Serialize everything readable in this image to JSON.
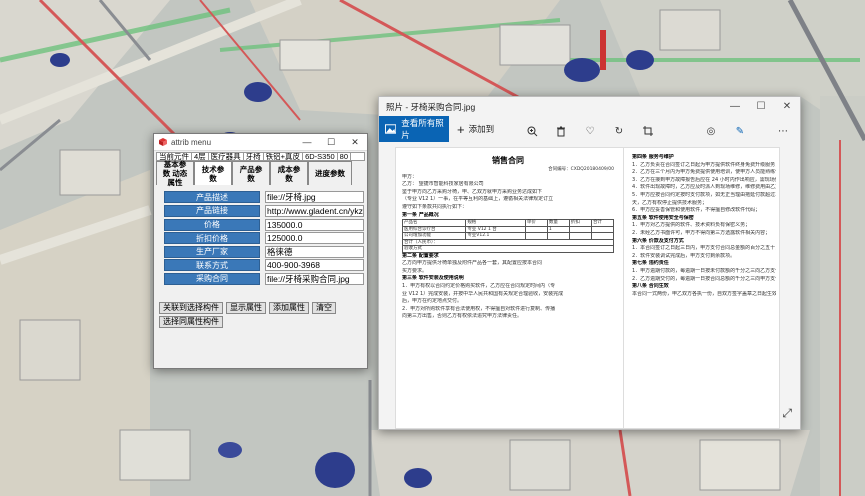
{
  "attrib": {
    "title": "attrib menu",
    "current_row": [
      "当前元件",
      "4层",
      "医疗器具",
      "牙椅",
      "铁铝+真皮",
      "6D-S350",
      "80"
    ],
    "tabs": [
      "基本参数 动态属性",
      "技术参数",
      "产品参数",
      "成本参数",
      "进度参数"
    ],
    "fields": [
      {
        "label": "产品描述",
        "value": "file://牙椅.jpg"
      },
      {
        "label": "产品链接",
        "value": "http://www.gladent.cn/ykzhz"
      },
      {
        "label": "价格",
        "value": "135000.0"
      },
      {
        "label": "折扣价格",
        "value": "125000.0"
      },
      {
        "label": "生产厂家",
        "value": "格徕德"
      },
      {
        "label": "联系方式",
        "value": "400-900-3968"
      },
      {
        "label": "采购合同",
        "value": "file://牙椅采购合同.jpg"
      }
    ],
    "buttons": [
      "关联到选择构件",
      "显示属性",
      "添加属性",
      "清空",
      "选择同属性构件"
    ]
  },
  "photos": {
    "title": "照片 - 牙椅采购合同.jpg",
    "view_all": "查看所有照片",
    "add_to": "添加到",
    "doc": {
      "title": "销售合同",
      "number": "合同编号：CXDQ20180409/00",
      "left": [
        "甲方：",
        "乙方：   望捷市智能科技家居有限公司",
        "   鉴于甲方向乙方采购牙椅，甲、乙双方就甲方采购业务达成如下",
        "（专业 V12 1）一事，在平等互利的基础上，遵循相关法律规定订立",
        "遵守如下条款共同执行如下：",
        "第一条  产品概况",
        "第二条  配置要求",
        "乙方向甲方提供牙椅单独及附件产品各一套，其配置应按本合同",
        "买方要求。",
        "第三条  软件安装及使用说明",
        "1．甲方有权以合同约定价格购买软件，乙方应在合同规定时间内（专",
        "业 V12 1）完成安装，并按中华人民共和国有关规定合理验收，安装完成",
        "后，甲方在约定地点交付。",
        "2．甲方对所购软件享有合法使用权，不得擅自对软件进行复制、传播",
        "向第三方出售，否则乙方有权依法追究甲方法律责任。"
      ],
      "table": [
        [
          "产品名",
          "规格",
          "单价",
          "数量",
          "折扣",
          "合计"
        ],
        [
          "医用综合诊疗台",
          "专业 V12 1 台",
          "",
          "1",
          "",
          ""
        ],
        [
          "公司增加功能",
          "专业V12.1",
          "",
          "",
          "",
          ""
        ],
        [
          "合计（人民币）：",
          "",
          "",
          "",
          "",
          ""
        ],
        [
          "验收方式",
          "",
          "",
          "",
          "",
          ""
        ]
      ],
      "right": [
        "第四条  服务与维护",
        "1．乙方负责在合同签订之日起为甲方提供软件终身免费升级服务；",
        "2．乙方在三个月内为甲方免费提供使用培训，使甲方人员能熟练使用",
        "3．乙方在接到甲方故障报告后应在 24 小时内作出响应，需现场处理",
        "4．软件出现故障时，乙方应及时派人到现场维修，维修费用由乙方负担",
        "5．甲方应按合同约定按时支付款项，如无正当理由拖延付款超过三十",
        "天，乙方有权停止提供技术服务；",
        "6．甲方应妥善保管和使用软件，不得擅自修改软件代码；",
        "第五条  软件使用安全与保密",
        "1．甲方对乙方提供的软件、技术资料负有保密义务；",
        "2．未经乙方书面许可，甲方不得向第三方透露软件相关内容；",
        "第六条  价款及支付方式",
        "1．本合同签订之日起三日内，甲方支付合同总金额的百分之五十；",
        "2．软件安装调试完成后，甲方支付剩余款项。",
        "第七条  违约责任",
        "1．甲方逾期付款的，每逾期一日按未付款额的千分之三向乙方支付违约金；",
        "2．乙方逾期交付的，每逾期一日按合同总额的千分之三向甲方支付违约金；",
        "第八条  合同生效",
        "本合同一式两份，甲乙双方各执一份，自双方签字盖章之日起生效。"
      ]
    }
  }
}
